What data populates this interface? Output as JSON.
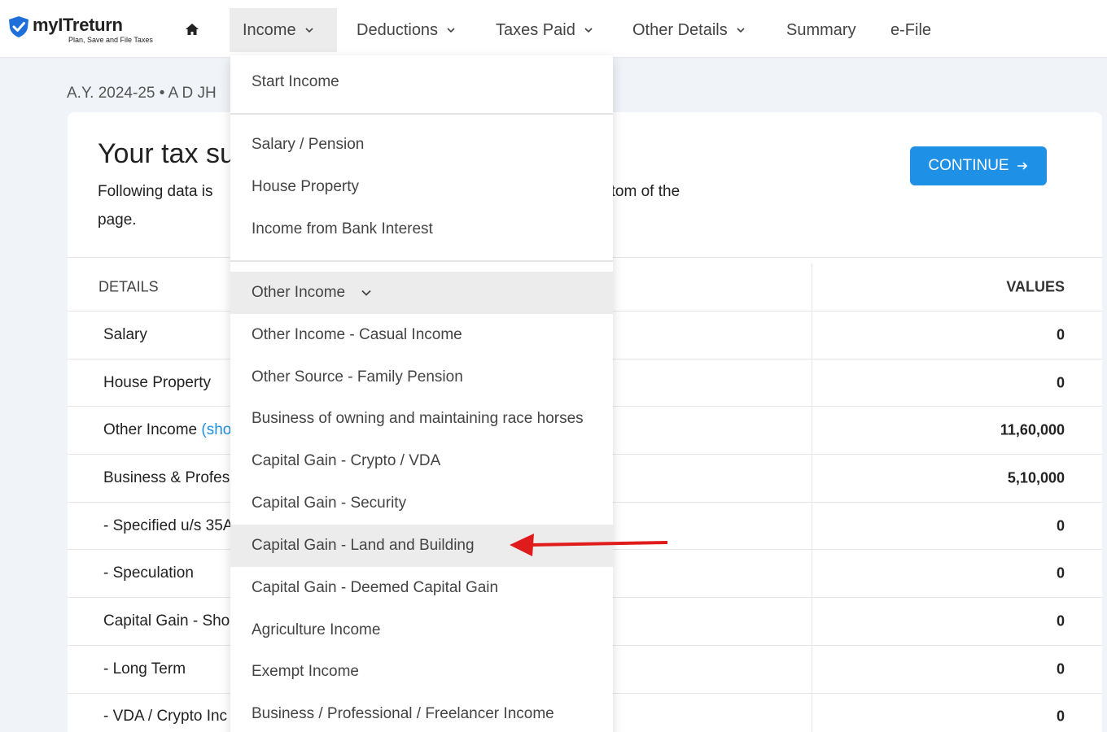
{
  "brand": {
    "name": "myITreturn",
    "tagline": "Plan, Save and File Taxes",
    "accent_color": "#1e90e6"
  },
  "nav": {
    "home_icon": "home-icon",
    "income": "Income",
    "deductions": "Deductions",
    "taxes_paid": "Taxes Paid",
    "other_details": "Other Details",
    "summary": "Summary",
    "efile": "e-File"
  },
  "page": {
    "ay_line": "A.Y. 2024-25 • A D JH",
    "title": "Your tax su",
    "desc_left": "Following data is",
    "desc_right": "ottom of the",
    "desc_line2": "page.",
    "continue_label": "CONTINUE"
  },
  "table": {
    "header_details": "DETAILS",
    "header_values": "VALUES",
    "rows": [
      {
        "label": "Salary",
        "value": "0"
      },
      {
        "label": "House Property",
        "value": "0"
      },
      {
        "label": "Other Income",
        "link": "(sho",
        "value": "11,60,000"
      },
      {
        "label": "Business & Profes",
        "value": "5,10,000"
      },
      {
        "label": "- Specified u/s 35A",
        "value": "0"
      },
      {
        "label": "- Speculation",
        "value": "0"
      },
      {
        "label": "Capital Gain - Sho",
        "value": "0"
      },
      {
        "label": "- Long Term",
        "value": "0"
      },
      {
        "label": "- VDA / Crypto Inc",
        "value": "0"
      }
    ]
  },
  "dropdown": {
    "items": [
      "Start Income",
      "Salary / Pension",
      "House Property",
      "Income from Bank Interest",
      "Other Income",
      "Other Income - Casual Income",
      "Other Source - Family Pension",
      "Business of owning and maintaining race horses",
      "Capital Gain - Crypto / VDA",
      "Capital Gain - Security",
      "Capital Gain - Land and Building",
      "Capital Gain - Deemed Capital Gain",
      "Agriculture Income",
      "Exempt Income",
      "Business / Professional / Freelancer Income"
    ],
    "highlighted_item": "Capital Gain - Land and Building",
    "annotation_color": "#e01b1b"
  }
}
